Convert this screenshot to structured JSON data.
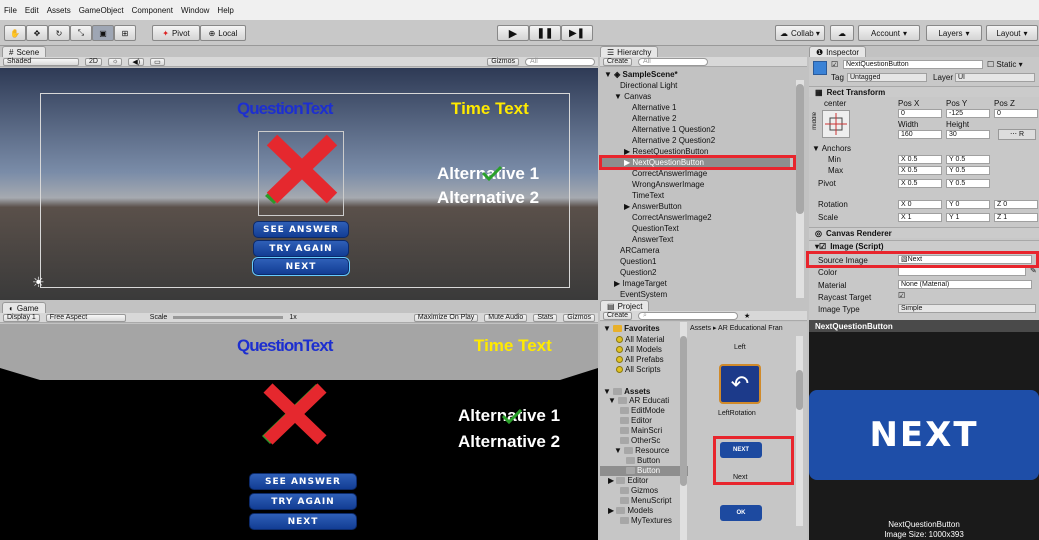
{
  "menu": [
    "File",
    "Edit",
    "Assets",
    "GameObject",
    "Component",
    "Window",
    "Help"
  ],
  "toolbar": {
    "pivot": "Pivot",
    "local": "Local",
    "collab": "Collab ▾",
    "account": "Account",
    "layers": "Layers",
    "layout": "Layout"
  },
  "scene": {
    "tab": "Scene",
    "shaded": "Shaded",
    "mode2d": "2D",
    "gizmos": "Gizmos",
    "search": "All",
    "question_text": "QuestionText",
    "time_text": "Time Text",
    "alt1": "Alternative 1",
    "alt2": "Alternative 2",
    "see_answer": "SEE ANSWER",
    "try_again": "TRY AGAIN",
    "next": "NEXT"
  },
  "game": {
    "tab": "Game",
    "display": "Display 1",
    "aspect": "Free Aspect",
    "scale": "Scale",
    "scale_val": "1x",
    "maximize": "Maximize On Play",
    "mute": "Mute Audio",
    "stats": "Stats",
    "gizmos": "Gizmos"
  },
  "hierarchy": {
    "tab": "Hierarchy",
    "create": "Create",
    "search": "All",
    "scene": "SampleScene*",
    "items": [
      "Directional Light",
      "Canvas",
      "Alternative 1",
      "Alternative 2",
      "Alternative 1 Question2",
      "Alternative 2 Question2",
      "ResetQuestionButton",
      "NextQuestionButton",
      "CorrectAnswerImage",
      "WrongAnswerImage",
      "TimeText",
      "AnswerButton",
      "CorrectAnswerImage2",
      "QuestionText",
      "AnswerText",
      "ARCamera",
      "Question1",
      "Question2",
      "ImageTarget",
      "EventSystem"
    ]
  },
  "project": {
    "tab": "Project",
    "create": "Create",
    "breadcrumb": "Assets ▸ AR Educational Fran",
    "favorites": "Favorites",
    "fav_items": [
      "All Material",
      "All Models",
      "All Prefabs",
      "All Scripts"
    ],
    "assets": "Assets",
    "tree": [
      "AR Educati",
      "EditMode",
      "Editor",
      "MainScri",
      "OtherSc",
      "Resource",
      "Button",
      "Button",
      "Editor",
      "Gizmos",
      "MenuScript",
      "Models",
      "MyTextures"
    ],
    "asset_labels": [
      "Left",
      "LeftRotation",
      "Next"
    ],
    "thumb_next": "NEXT",
    "thumb_ok": "OK"
  },
  "inspector": {
    "tab": "Inspector",
    "object_name": "NextQuestionButton",
    "static": "Static",
    "tag_label": "Tag",
    "tag": "Untagged",
    "layer_label": "Layer",
    "layer": "UI",
    "rect": "Rect Transform",
    "center": "center",
    "middle": "middle",
    "posx_l": "Pos X",
    "posy_l": "Pos Y",
    "posz_l": "Pos Z",
    "posx": "0",
    "posy": "-125",
    "posz": "0",
    "width_l": "Width",
    "height_l": "Height",
    "width": "160",
    "height": "30",
    "anchors": "Anchors",
    "min": "Min",
    "max": "Max",
    "pivot": "Pivot",
    "min_x": "0.5",
    "min_y": "0.5",
    "max_x": "0.5",
    "max_y": "0.5",
    "piv_x": "0.5",
    "piv_y": "0.5",
    "rotation": "Rotation",
    "rot_x": "0",
    "rot_y": "0",
    "rot_z": "0",
    "scale": "Scale",
    "sc_x": "1",
    "sc_y": "1",
    "sc_z": "1",
    "canvas_renderer": "Canvas Renderer",
    "image_script": "Image (Script)",
    "source_image_l": "Source Image",
    "source_image": "Next",
    "color_l": "Color",
    "material_l": "Material",
    "material": "None (Material)",
    "raycast_l": "Raycast Target",
    "image_type_l": "Image Type",
    "image_type": "Simple"
  },
  "preview": {
    "tab": "NextQuestionButton",
    "text": "NEXT",
    "name": "NextQuestionButton",
    "size": "Image Size: 1000x393"
  }
}
